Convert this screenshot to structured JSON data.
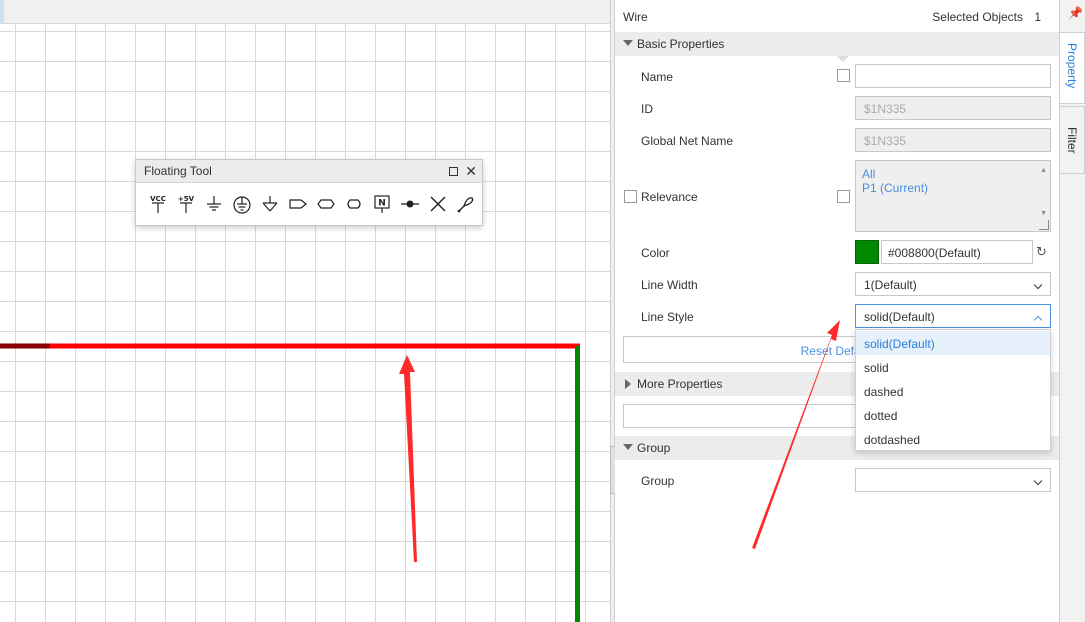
{
  "floating_tool": {
    "title": "Floating Tool",
    "tools": [
      {
        "name": "vcc-icon",
        "label": "VCC"
      },
      {
        "name": "plus5v-icon",
        "label": "+5V"
      },
      {
        "name": "ground-icon"
      },
      {
        "name": "earth-ground-icon"
      },
      {
        "name": "analog-ground-icon"
      },
      {
        "name": "net-port-right-icon"
      },
      {
        "name": "net-port-bidir-icon"
      },
      {
        "name": "net-port-io-icon"
      },
      {
        "name": "net-label-icon",
        "label": "N"
      },
      {
        "name": "junction-icon"
      },
      {
        "name": "no-connect-icon"
      },
      {
        "name": "probe-icon"
      }
    ]
  },
  "panel": {
    "title": "Wire",
    "selected_label": "Selected Objects",
    "selected_count": "1",
    "sections": {
      "basic": "Basic Properties",
      "more": "More Properties",
      "group": "Group"
    },
    "fields": {
      "name_label": "Name",
      "name_value": "",
      "id_label": "ID",
      "id_value": "$1N335",
      "net_label": "Global Net Name",
      "net_value": "$1N335",
      "relevance_label": "Relevance",
      "relevance_items": [
        "All",
        "P1 (Current)"
      ],
      "color_label": "Color",
      "color_value": "#008800(Default)",
      "color_hex": "#008800",
      "line_width_label": "Line Width",
      "line_width_value": "1(Default)",
      "line_style_label": "Line Style",
      "line_style_value": "solid(Default)",
      "reset_label": "Reset Default",
      "group_label": "Group",
      "group_value": ""
    },
    "line_style_options": [
      "solid(Default)",
      "solid",
      "dashed",
      "dotted",
      "dotdashed"
    ]
  },
  "side_tabs": {
    "property": "Property",
    "filter": "Filter"
  },
  "colors": {
    "wire_selected": "#ff0000",
    "wire_green": "#008800",
    "accent": "#2b7fd8",
    "annotation_arrow": "#ff2a2a"
  }
}
